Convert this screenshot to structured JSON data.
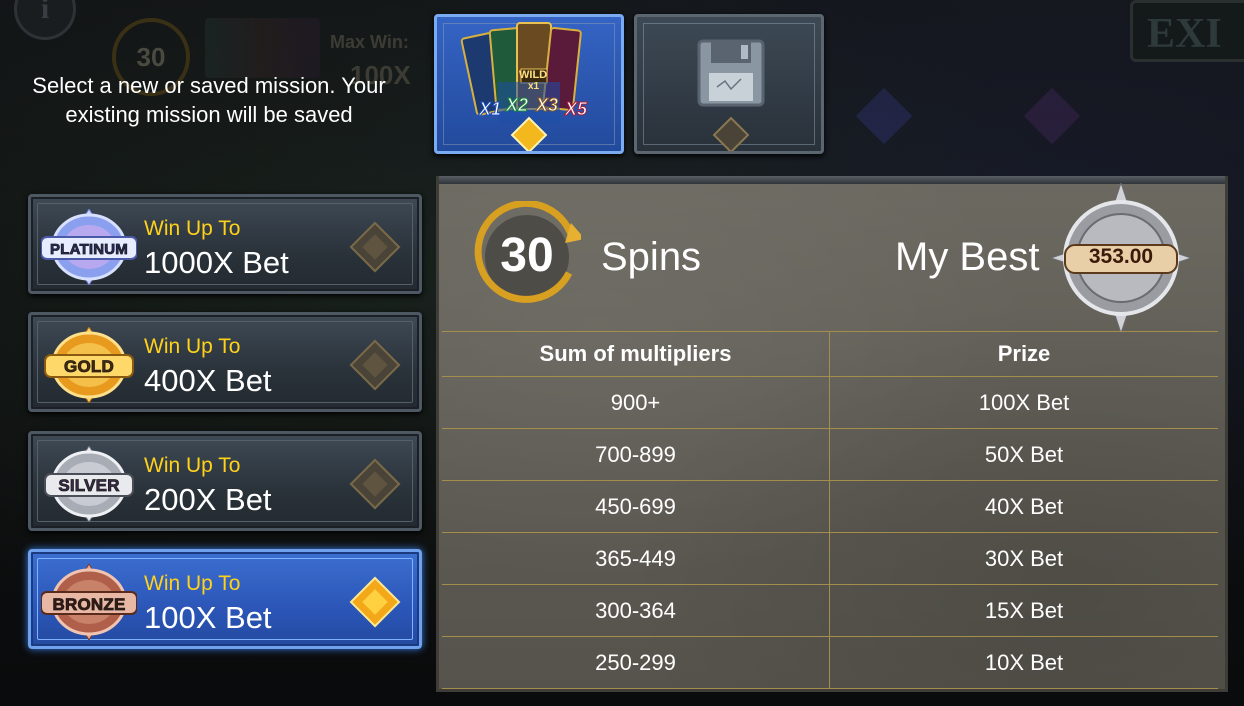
{
  "background": {
    "info_icon": "i",
    "spins_counter": "30",
    "max_win_label": "Max Win:",
    "max_win_value": "100X",
    "exit_label": "EXI"
  },
  "prompt": {
    "text": "Select a new or saved mission. Your existing mission will be saved"
  },
  "missions": [
    {
      "tier": "PLATINUM",
      "win_label": "Win Up To",
      "win_value": "1000X Bet",
      "color": "#9fb6ff",
      "selected": false
    },
    {
      "tier": "GOLD",
      "win_label": "Win Up To",
      "win_value": "400X Bet",
      "color": "#f4b32a",
      "selected": false
    },
    {
      "tier": "SILVER",
      "win_label": "Win Up To",
      "win_value": "200X Bet",
      "color": "#c8ccd2",
      "selected": false
    },
    {
      "tier": "BRONZE",
      "win_label": "Win Up To",
      "win_value": "100X Bet",
      "color": "#c0826a",
      "selected": true
    }
  ],
  "top_buttons": {
    "new_mission": {
      "icon": "cards-icon",
      "card_labels": [
        "X1",
        "X2",
        "X3",
        "X5"
      ],
      "wild_label": "WILD",
      "wild_sub": "x1"
    },
    "saved_mission": {
      "icon": "floppy-disk-icon"
    }
  },
  "panel": {
    "spins_count": "30",
    "spins_label": "Spins",
    "best_label": "My Best",
    "best_value": "353.00",
    "table": {
      "headers": [
        "Sum of multipliers",
        "Prize"
      ],
      "rows": [
        [
          "900+",
          "100X Bet"
        ],
        [
          "700-899",
          "50X Bet"
        ],
        [
          "450-699",
          "40X Bet"
        ],
        [
          "365-449",
          "30X Bet"
        ],
        [
          "300-364",
          "15X Bet"
        ],
        [
          "250-299",
          "10X Bet"
        ]
      ]
    }
  },
  "colors": {
    "accent_blue": "#2b56b8",
    "win_label_yellow": "#ffd21a",
    "table_line": "#a58e4c",
    "panel_stone": "#5c5a52"
  }
}
